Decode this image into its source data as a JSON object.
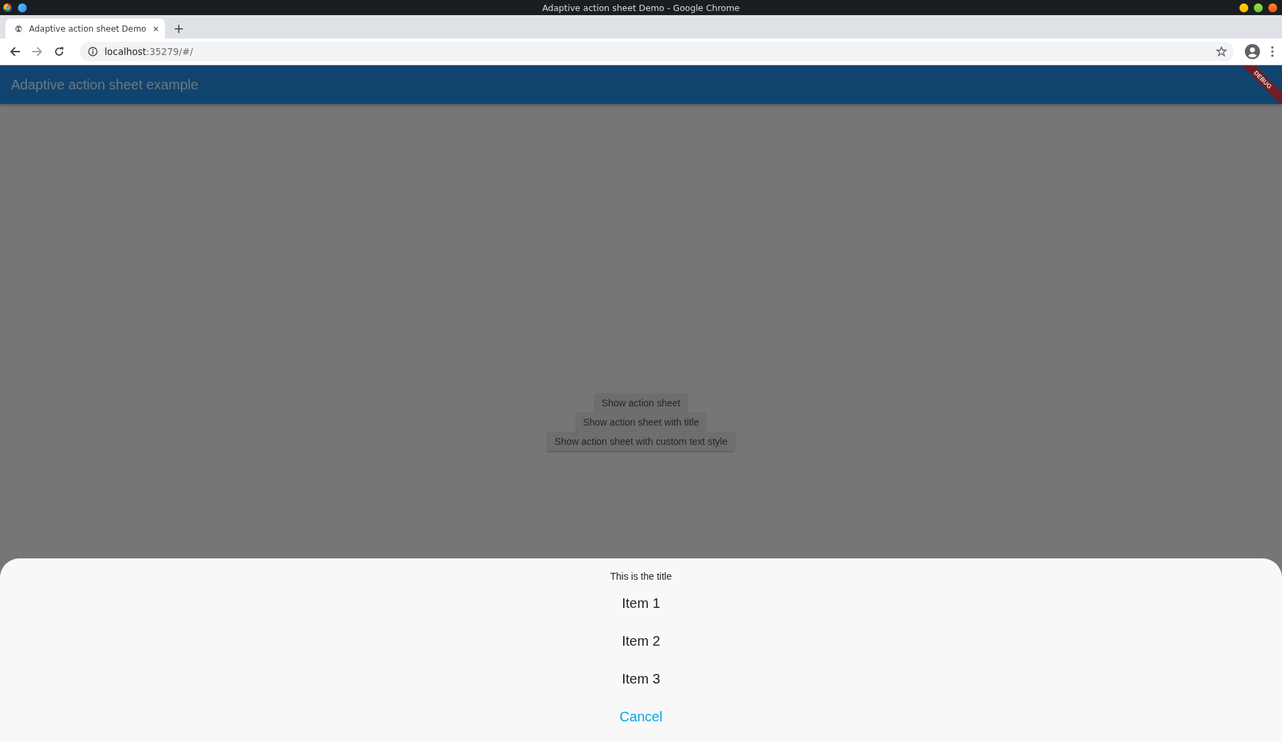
{
  "window": {
    "title": "Adaptive action sheet Demo - Google Chrome"
  },
  "tabs": [
    {
      "label": "Adaptive action sheet Demo",
      "selected": true
    }
  ],
  "address": {
    "host": "localhost",
    "path": ":35279/#/"
  },
  "app_bar": {
    "title": "Adaptive action sheet example",
    "debug_banner": "DEBUG"
  },
  "buttons": [
    "Show action sheet",
    "Show action sheet with title",
    "Show action sheet with custom text style"
  ],
  "action_sheet": {
    "title": "This is the title",
    "items": [
      "Item 1",
      "Item 2",
      "Item 3"
    ],
    "cancel": "Cancel"
  }
}
